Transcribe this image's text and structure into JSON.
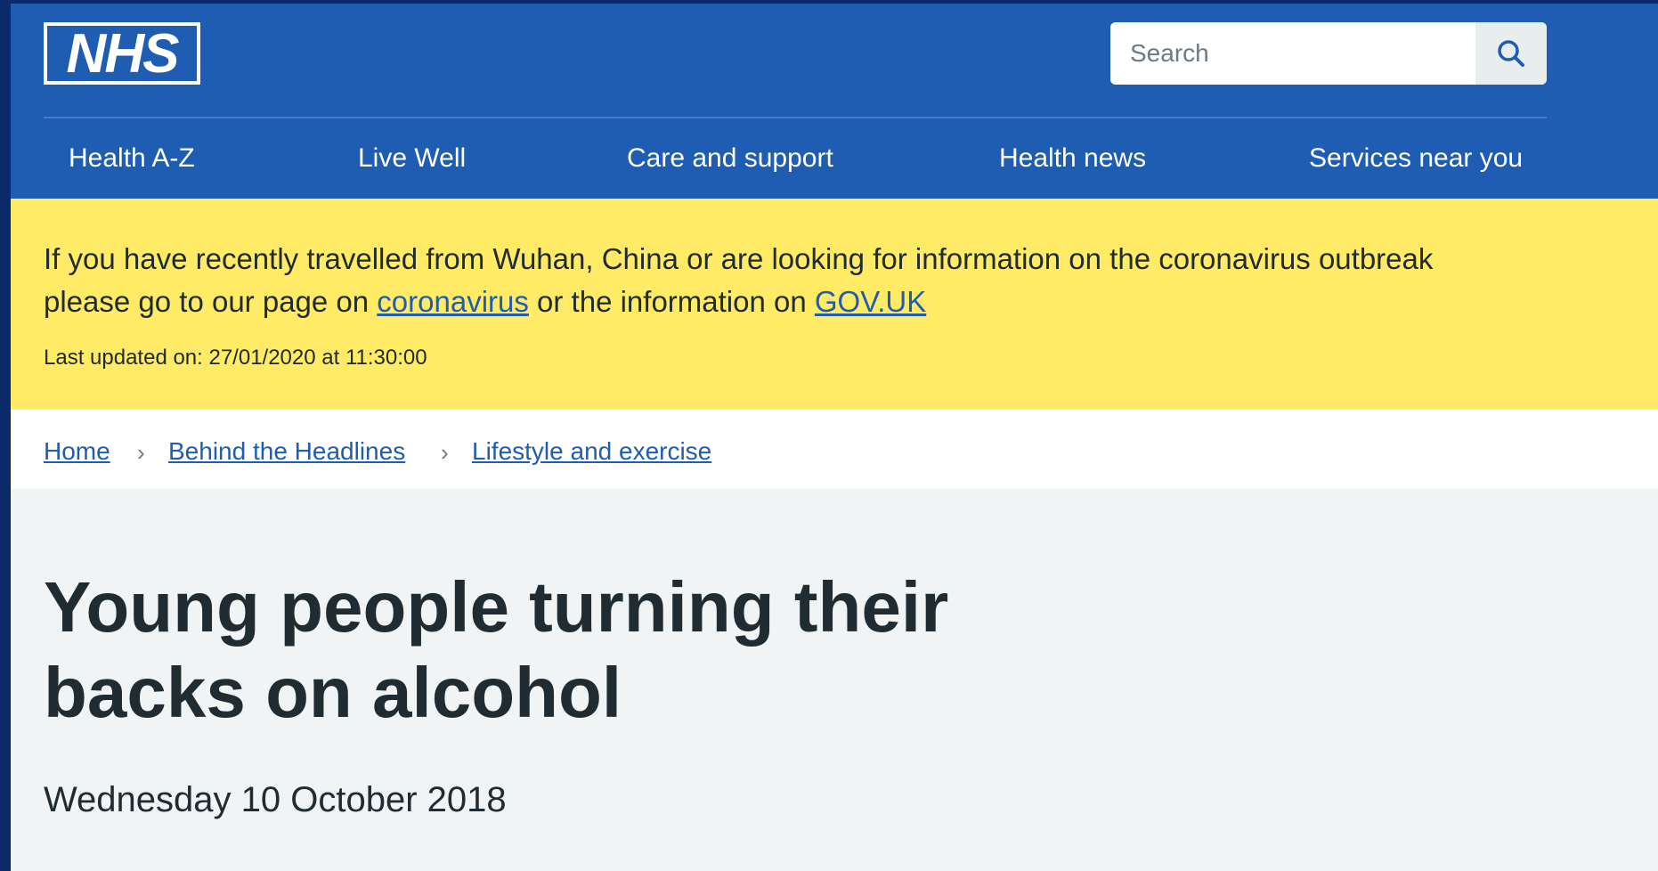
{
  "header": {
    "logo_text": "NHS",
    "search": {
      "placeholder": "Search",
      "button_icon": "search-icon"
    },
    "nav": [
      {
        "label": "Health A-Z"
      },
      {
        "label": "Live Well"
      },
      {
        "label": "Care and support"
      },
      {
        "label": "Health news"
      },
      {
        "label": "Services near you"
      }
    ]
  },
  "alert": {
    "text_before": "If you have recently travelled from Wuhan, China or are looking for information on the coronavirus outbreak please go to our page on ",
    "link1": "coronavirus",
    "text_middle": " or the information on ",
    "link2": "GOV.UK",
    "updated": "Last updated on: 27/01/2020 at 11:30:00"
  },
  "breadcrumb": {
    "items": [
      {
        "label": "Home"
      },
      {
        "label": "Behind the Headlines"
      },
      {
        "label": "Lifestyle and exercise"
      }
    ],
    "separator": "›"
  },
  "article": {
    "title": "Young people turning their backs on alcohol",
    "date": "Wednesday 10 October 2018"
  },
  "colors": {
    "nhs_blue": "#1f5db3",
    "alert_yellow": "#ffeb66",
    "text_dark": "#212b32",
    "page_bg": "#f0f4f5"
  }
}
